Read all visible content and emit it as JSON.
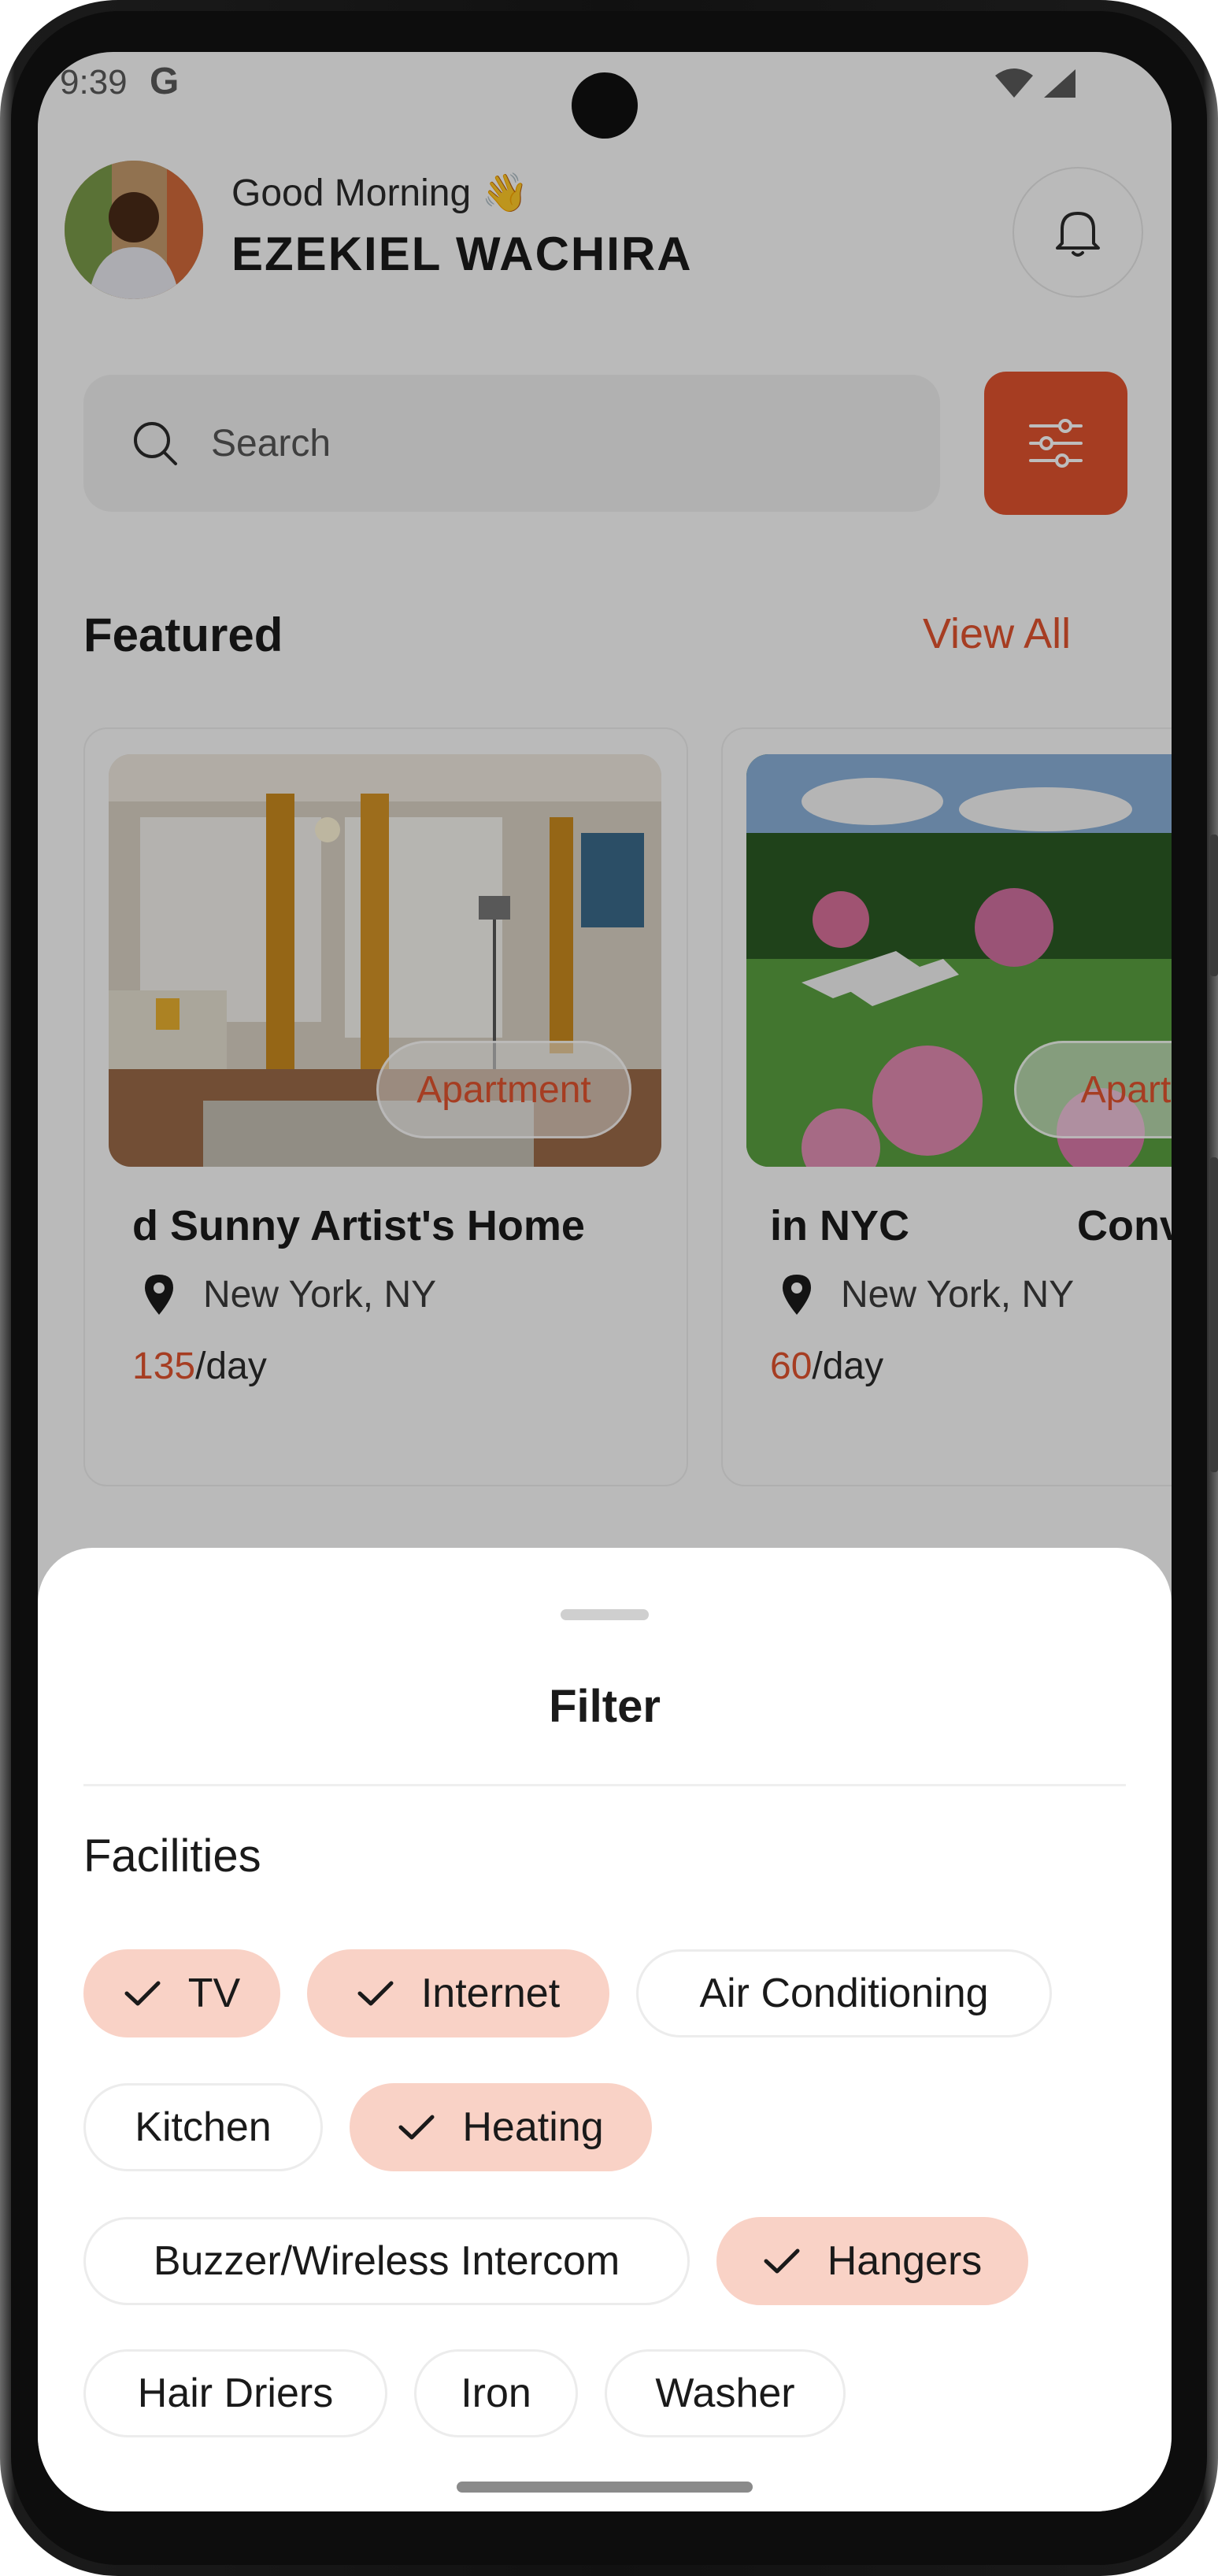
{
  "status_bar": {
    "time": "9:39",
    "carrier_icon": "G"
  },
  "header": {
    "greeting": "Good Morning 👋",
    "user_name": "EZEKIEL WACHIRA"
  },
  "search": {
    "placeholder": "Search"
  },
  "featured": {
    "title": "Featured",
    "view_all": "View All",
    "cards": [
      {
        "badge": "Apartment",
        "title": "d Sunny Artist's Home",
        "location": "New York, NY",
        "price_amount": "135",
        "price_unit": "/day"
      },
      {
        "badge": "Apartm",
        "title": "in NYC",
        "title_extra": "Conv",
        "location": "New York, NY",
        "price_amount": "60",
        "price_unit": "/day"
      }
    ]
  },
  "filter_sheet": {
    "title": "Filter",
    "section": "Facilities",
    "chips": [
      {
        "label": "TV",
        "selected": true
      },
      {
        "label": "Internet",
        "selected": true
      },
      {
        "label": "Air Conditioning",
        "selected": false
      },
      {
        "label": "Kitchen",
        "selected": false
      },
      {
        "label": "Heating",
        "selected": true
      },
      {
        "label": "Buzzer/Wireless Intercom",
        "selected": false
      },
      {
        "label": "Hangers",
        "selected": true
      },
      {
        "label": "Hair Driers",
        "selected": false
      },
      {
        "label": "Iron",
        "selected": false
      },
      {
        "label": "Washer",
        "selected": false
      }
    ]
  },
  "colors": {
    "accent": "#e0532e",
    "chip_selected": "#f9d2c6"
  }
}
